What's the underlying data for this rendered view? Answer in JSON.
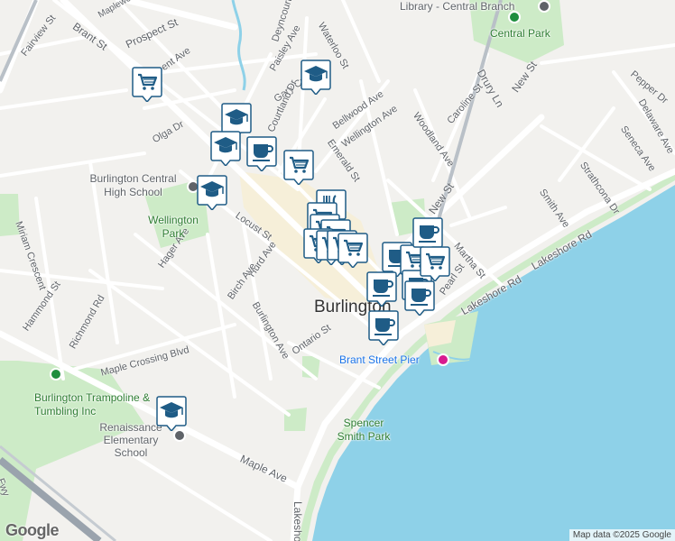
{
  "map": {
    "city_label": "Burlington",
    "attribution": "Map data ©2025 Google",
    "google_logo": "Google",
    "colors": {
      "land": "#f2f1ee",
      "water": "#8ed1e8",
      "park": "#cdebc7",
      "road": "#ffffff",
      "highway": "#9aa3ad",
      "marker": "#1f5c86",
      "downtown": "#f6efd9"
    },
    "streets": [
      {
        "text": "Fairview St",
        "angle": -52
      },
      {
        "text": "Brant St",
        "angle": 35
      },
      {
        "text": "Prospect St",
        "angle": -25
      },
      {
        "text": "Maplewood",
        "angle": -30
      },
      {
        "text": "Deyncourt Dr",
        "angle": -72
      },
      {
        "text": "Waterloo St",
        "angle": 60
      },
      {
        "text": "Paisley Ave",
        "angle": -60
      },
      {
        "text": "Gary Crescent",
        "angle": -35
      },
      {
        "text": "Courtland Dr",
        "angle": -65
      },
      {
        "text": "Bellwood Ave",
        "angle": -35
      },
      {
        "text": "Wellington Ave",
        "angle": -35
      },
      {
        "text": "Emerald St",
        "angle": 55
      },
      {
        "text": "Woodland Ave",
        "angle": 55
      },
      {
        "text": "Caroline St",
        "angle": -50
      },
      {
        "text": "Drury Ln",
        "angle": 60
      },
      {
        "text": "New St",
        "angle": -55
      },
      {
        "text": "New St",
        "angle": -55
      },
      {
        "text": "Pepper Dr",
        "angle": 40
      },
      {
        "text": "Delaware Ave",
        "angle": 60
      },
      {
        "text": "Seneca Ave",
        "angle": 55
      },
      {
        "text": "Strathcona Dr",
        "angle": 55
      },
      {
        "text": "Smith Ave",
        "angle": 55
      },
      {
        "text": "Lakeshore Rd",
        "angle": -30
      },
      {
        "text": "Lakeshore Rd",
        "angle": -30
      },
      {
        "text": "Martha St",
        "angle": 50
      },
      {
        "text": "Pearl St",
        "angle": -55
      },
      {
        "text": "Olga Dr",
        "angle": -30
      },
      {
        "text": "Locust St",
        "angle": 35
      },
      {
        "text": "Hager Ave",
        "angle": -55
      },
      {
        "text": "Hurd Ave",
        "angle": -55
      },
      {
        "text": "Birch Ave",
        "angle": -55
      },
      {
        "text": "Burlington Ave",
        "angle": 60
      },
      {
        "text": "Ontario St",
        "angle": -35
      },
      {
        "text": "Miriam Crescent",
        "angle": 70
      },
      {
        "text": "Hammond St",
        "angle": -55
      },
      {
        "text": "Richmond Rd",
        "angle": -60
      },
      {
        "text": "Maple Crossing Blvd",
        "angle": -15
      },
      {
        "text": "Maple Ave",
        "angle": 25
      },
      {
        "text": "Lakeshore",
        "angle": 90
      },
      {
        "text": "Fwy",
        "angle": 70
      },
      {
        "text": "ent Ave",
        "angle": -35
      }
    ],
    "pois": [
      {
        "name": "Library - Central Branch",
        "type": "library"
      },
      {
        "name": "Central Park",
        "type": "park"
      },
      {
        "name": "Burlington Central High School",
        "type": "school"
      },
      {
        "name": "Wellington Park",
        "type": "park"
      },
      {
        "name": "Brant Street Pier",
        "type": "attraction"
      },
      {
        "name": "Spencer Smith Park",
        "type": "park"
      },
      {
        "name": "Burlington Trampoline & Tumbling Inc",
        "type": "recreation"
      },
      {
        "name": "Renaissance Elementary School",
        "type": "school"
      }
    ],
    "markers": [
      {
        "icon": "shopping-cart-icon"
      },
      {
        "icon": "graduation-cap-icon"
      },
      {
        "icon": "graduation-cap-icon"
      },
      {
        "icon": "graduation-cap-icon"
      },
      {
        "icon": "coffee-cup-icon"
      },
      {
        "icon": "shopping-cart-icon"
      },
      {
        "icon": "graduation-cap-icon"
      },
      {
        "icon": "restaurant-icon"
      },
      {
        "icon": "shopping-cart-icon"
      },
      {
        "icon": "shopping-cart-icon"
      },
      {
        "icon": "shopping-cart-icon"
      },
      {
        "icon": "shopping-cart-icon"
      },
      {
        "icon": "shopping-cart-icon"
      },
      {
        "icon": "shopping-cart-icon"
      },
      {
        "icon": "shopping-cart-icon"
      },
      {
        "icon": "coffee-cup-icon"
      },
      {
        "icon": "shopping-cart-icon"
      },
      {
        "icon": "coffee-cup-icon"
      },
      {
        "icon": "coffee-cup-icon"
      },
      {
        "icon": "coffee-cup-icon"
      },
      {
        "icon": "shopping-cart-icon"
      },
      {
        "icon": "coffee-cup-icon"
      },
      {
        "icon": "coffee-cup-icon"
      },
      {
        "icon": "graduation-cap-icon"
      }
    ]
  }
}
